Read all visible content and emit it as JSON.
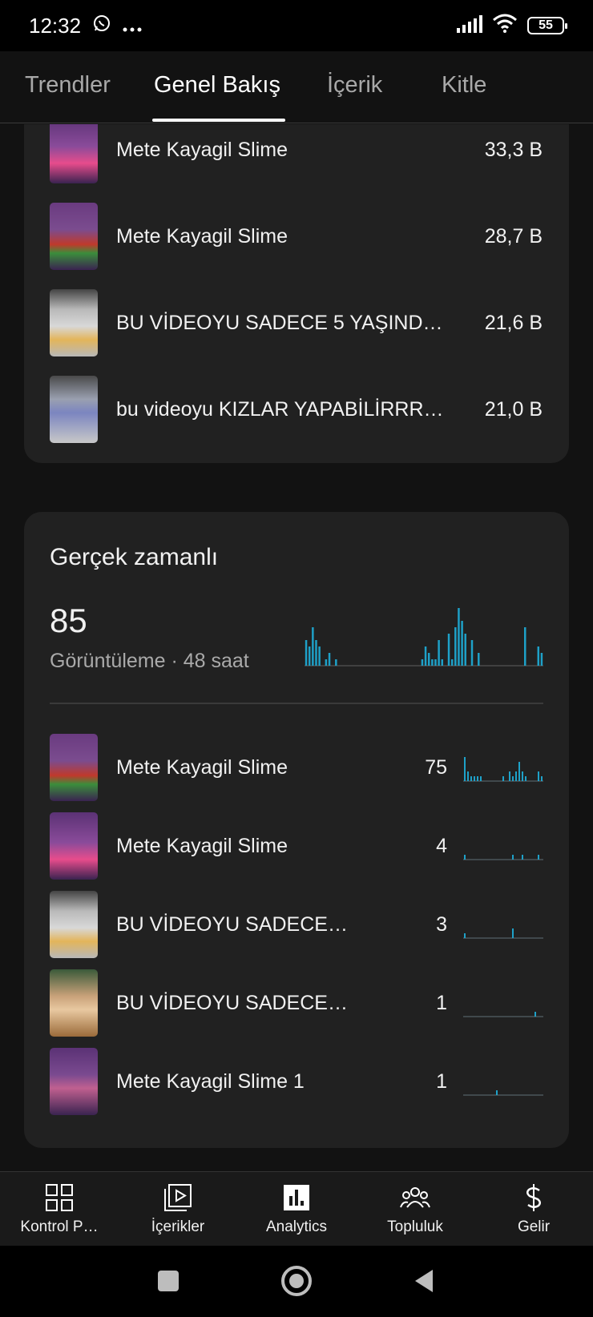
{
  "status": {
    "time": "12:32",
    "battery": "55",
    "icons": [
      "whatsapp-icon",
      "more-dots-icon",
      "signal-icon",
      "wifi-icon",
      "battery-icon"
    ]
  },
  "tabs": [
    "Trendler",
    "Genel Bakış",
    "İçerik",
    "Kitle"
  ],
  "active_tab": "Genel Bakış",
  "top_videos": [
    {
      "title": "Mete Kayagil Slime",
      "value": "33,3 B"
    },
    {
      "title": "Mete Kayagil Slime",
      "value": "28,7 B"
    },
    {
      "title": "BU VİDEOYU SADECE 5 YAŞIND…",
      "value": "21,6 B"
    },
    {
      "title": "bu videoyu KIZLAR YAPABİLİRRR…",
      "value": "21,0 B"
    }
  ],
  "realtime": {
    "title": "Gerçek zamanlı",
    "count": "85",
    "subtitle": "Görüntüleme · 48 saat",
    "bars": [
      4,
      3,
      6,
      4,
      3,
      0,
      1,
      2,
      0,
      1,
      0,
      0,
      0,
      0,
      0,
      0,
      0,
      0,
      0,
      0,
      0,
      0,
      0,
      0,
      0,
      0,
      0,
      0,
      0,
      0,
      0,
      0,
      0,
      0,
      0,
      1,
      3,
      2,
      1,
      1,
      4,
      1,
      0,
      5,
      1,
      6,
      9,
      7,
      5,
      0,
      4,
      0,
      2,
      0,
      0,
      0,
      0,
      0,
      0,
      0,
      0,
      0,
      0,
      0,
      0,
      0,
      6,
      0,
      0,
      0,
      3,
      2
    ],
    "videos": [
      {
        "title": "Mete Kayagil Slime",
        "count": "75",
        "spark": [
          5,
          2,
          1,
          1,
          1,
          1,
          0,
          0,
          0,
          0,
          0,
          0,
          1,
          0,
          2,
          1,
          2,
          4,
          2,
          1,
          0,
          0,
          0,
          2,
          1
        ]
      },
      {
        "title": "Mete Kayagil Slime",
        "count": "4",
        "spark": [
          1,
          0,
          0,
          0,
          0,
          0,
          0,
          0,
          0,
          0,
          0,
          0,
          0,
          0,
          0,
          1,
          0,
          0,
          1,
          0,
          0,
          0,
          0,
          1,
          0
        ]
      },
      {
        "title": "BU VİDEOYU SADECE…",
        "count": "3",
        "spark": [
          1,
          0,
          0,
          0,
          0,
          0,
          0,
          0,
          0,
          0,
          0,
          0,
          0,
          0,
          0,
          2,
          0,
          0,
          0,
          0,
          0,
          0,
          0,
          0,
          0
        ]
      },
      {
        "title": "BU VİDEOYU SADECE…",
        "count": "1",
        "spark": [
          0,
          0,
          0,
          0,
          0,
          0,
          0,
          0,
          0,
          0,
          0,
          0,
          0,
          0,
          0,
          0,
          0,
          0,
          0,
          0,
          0,
          0,
          1,
          0,
          0
        ]
      },
      {
        "title": "Mete Kayagil Slime 1",
        "count": "1",
        "spark": [
          0,
          0,
          0,
          0,
          0,
          0,
          0,
          0,
          0,
          0,
          1,
          0,
          0,
          0,
          0,
          0,
          0,
          0,
          0,
          0,
          0,
          0,
          0,
          0,
          0
        ]
      }
    ]
  },
  "bottom_nav": [
    {
      "label": "Kontrol P…",
      "icon": "dashboard-icon"
    },
    {
      "label": "İçerikler",
      "icon": "content-icon"
    },
    {
      "label": "Analytics",
      "icon": "analytics-icon"
    },
    {
      "label": "Topluluk",
      "icon": "community-icon"
    },
    {
      "label": "Gelir",
      "icon": "earn-icon"
    }
  ],
  "colors": {
    "accent": "#1ea1c8",
    "card": "#212121",
    "background": "#121212"
  }
}
